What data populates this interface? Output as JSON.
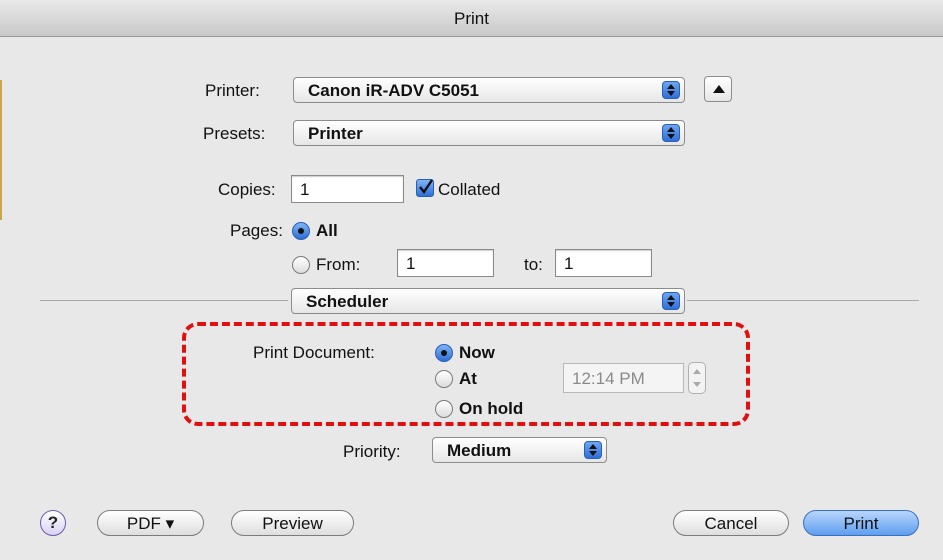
{
  "window": {
    "title": "Print"
  },
  "printer": {
    "label": "Printer:",
    "value": "Canon iR-ADV C5051"
  },
  "presets": {
    "label": "Presets:",
    "value": "Printer"
  },
  "copies": {
    "label": "Copies:",
    "value": "1",
    "collated_label": "Collated",
    "collated_checked": true
  },
  "pages": {
    "label": "Pages:",
    "all_label": "All",
    "from_label": "From:",
    "from_value": "1",
    "to_label": "to:",
    "to_value": "1",
    "selected": "All"
  },
  "panel": {
    "value": "Scheduler"
  },
  "scheduler": {
    "print_document_label": "Print Document:",
    "options": [
      "Now",
      "At",
      "On hold"
    ],
    "selected": "Now",
    "time_value": "12:14 PM"
  },
  "priority": {
    "label": "Priority:",
    "value": "Medium"
  },
  "footer": {
    "help_label": "?",
    "pdf_label": "PDF ▾",
    "preview_label": "Preview",
    "cancel_label": "Cancel",
    "print_label": "Print"
  },
  "colors": {
    "accent": "#2d6fd6",
    "highlight_dash": "#e01010"
  }
}
